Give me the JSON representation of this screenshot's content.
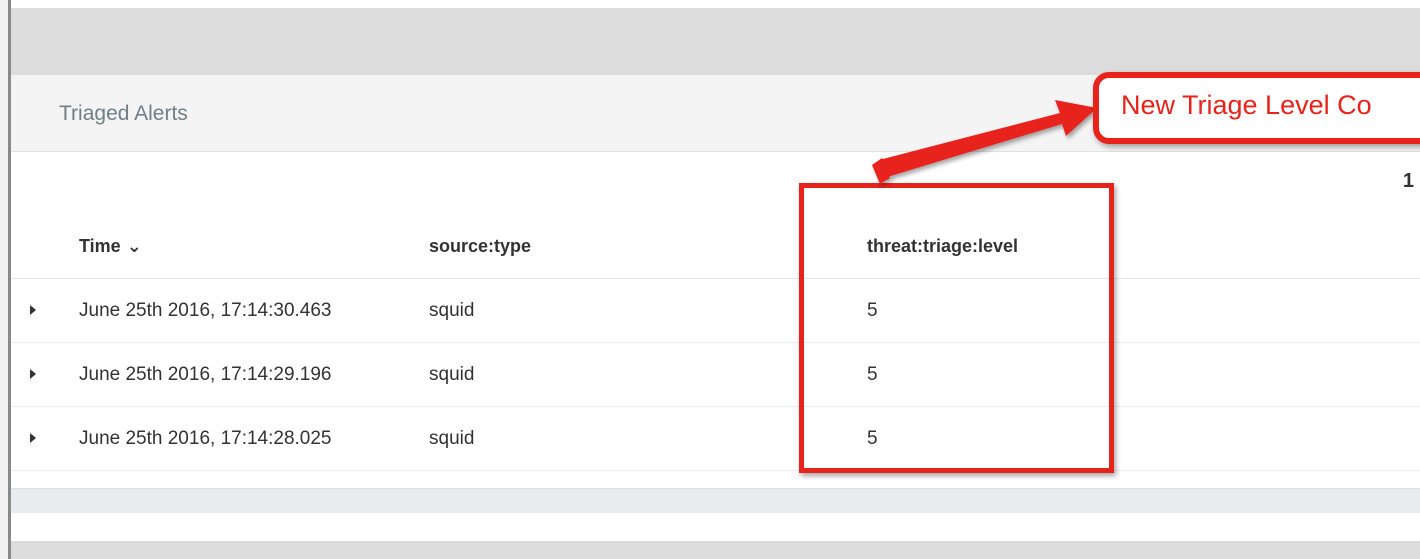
{
  "panel": {
    "title": "Triaged Alerts",
    "pager": "1"
  },
  "table": {
    "headers": {
      "time": "Time",
      "source_type": "source:type",
      "triage_level": "threat:triage:level"
    },
    "rows": [
      {
        "time": "June 25th 2016, 17:14:30.463",
        "source_type": "squid",
        "triage_level": "5"
      },
      {
        "time": "June 25th 2016, 17:14:29.196",
        "source_type": "squid",
        "triage_level": "5"
      },
      {
        "time": "June 25th 2016, 17:14:28.025",
        "source_type": "squid",
        "triage_level": "5"
      }
    ]
  },
  "annotation": {
    "callout_text": "New Triage Level Co",
    "color": "#e8231c"
  },
  "icons": {
    "sort": "sort-down-icon",
    "expand": "caret-right-icon"
  }
}
